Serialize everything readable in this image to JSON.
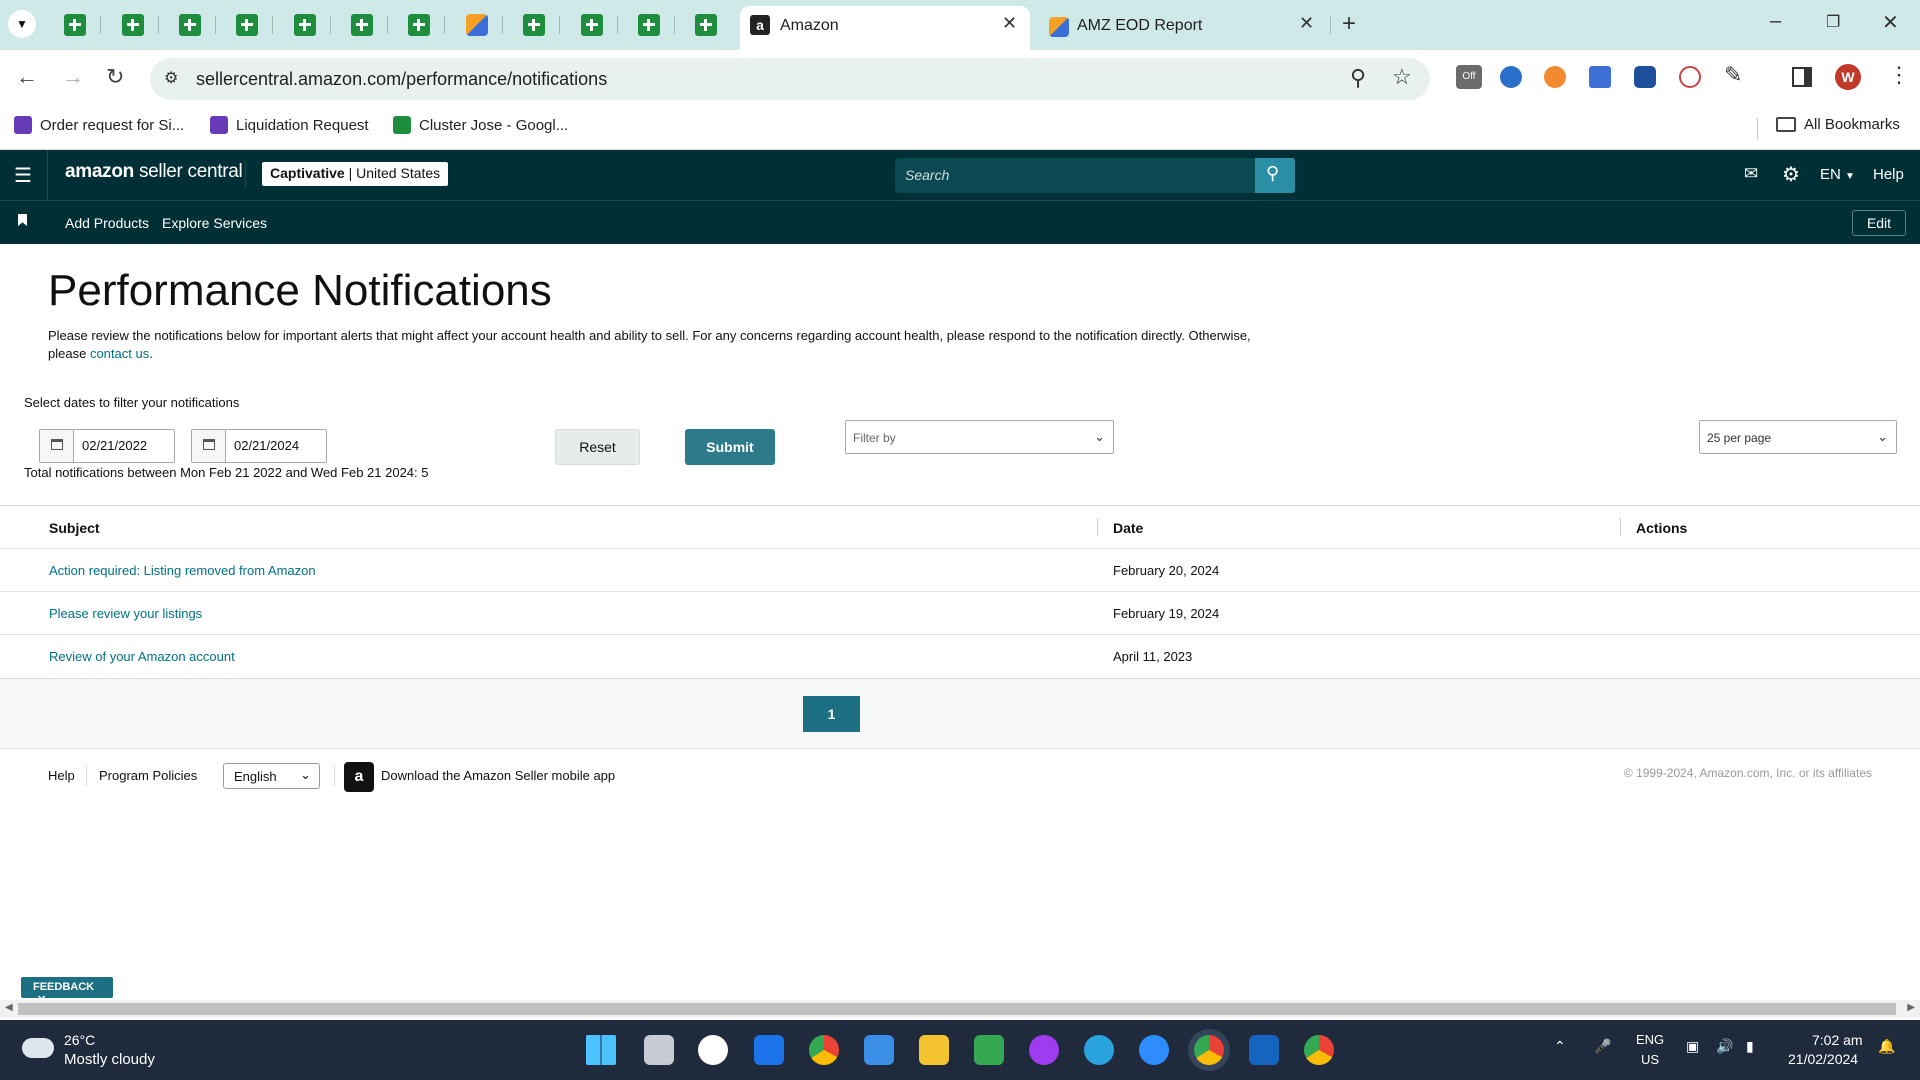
{
  "browser": {
    "tabs": [
      {
        "title": "Amazon",
        "active": true
      },
      {
        "title": "AMZ EOD Report",
        "active": false
      }
    ],
    "url": "sellercentral.amazon.com/performance/notifications",
    "bookmarks": [
      "Order request for Si...",
      "Liquidation Request",
      "Cluster Jose - Googl..."
    ],
    "all_bookmarks": "All Bookmarks",
    "profile_initial": "W"
  },
  "header": {
    "logo_main": "amazon",
    "logo_sub": "seller central",
    "store_name": "Captivative",
    "store_region": "| United States",
    "search_placeholder": "Search",
    "language": "EN",
    "help": "Help"
  },
  "nav": {
    "add_products": "Add Products",
    "explore_services": "Explore Services",
    "edit": "Edit"
  },
  "page": {
    "title": "Performance Notifications",
    "intro": "Please review the notifications below for important alerts that might affect your account health and ability to sell. For any concerns regarding account health, please respond to the notification directly. Otherwise, please",
    "intro_link": "contact us",
    "intro_end": "."
  },
  "filters": {
    "label": "Select dates to filter your notifications",
    "start_date": "02/21/2022",
    "end_date": "02/21/2024",
    "total": "Total notifications between Mon Feb 21 2022 and Wed Feb 21 2024: 5",
    "reset": "Reset",
    "submit": "Submit",
    "filter_by": "Filter by",
    "per_page": "25 per page"
  },
  "table": {
    "columns": [
      "Subject",
      "Date",
      "Actions"
    ],
    "rows": [
      {
        "subject": "Action required: Listing removed from Amazon",
        "date": "February 20, 2024"
      },
      {
        "subject": "Please review your listings",
        "date": "February 19, 2024"
      },
      {
        "subject": "Review of your Amazon account",
        "date": "April 11, 2023"
      }
    ]
  },
  "pagination": {
    "current": "1"
  },
  "footer": {
    "help": "Help",
    "program_policies": "Program Policies",
    "language": "English",
    "app_promo": "Download the Amazon Seller mobile app",
    "copyright": "© 1999-2024, Amazon.com, Inc. or its affiliates"
  },
  "feedback": "FEEDBACK",
  "taskbar": {
    "temperature": "26°C",
    "weather": "Mostly cloudy",
    "lang_top": "ENG",
    "lang_bottom": "US",
    "time": "7:02 am",
    "date": "21/02/2024"
  },
  "colors": {
    "header_bg": "#002f36",
    "link": "#007185",
    "submit": "#2d7a8a",
    "pager": "#1d6f83"
  }
}
